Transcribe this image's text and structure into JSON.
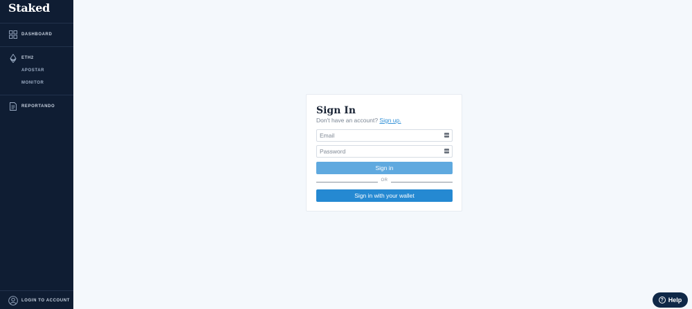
{
  "sidebar": {
    "logo": "Staked",
    "items": [
      {
        "label": "DASHBOARD",
        "icon": "grid-icon"
      },
      {
        "label": "ETH2",
        "icon": "ethereum-icon"
      },
      {
        "label": "APOSTAR",
        "icon": ""
      },
      {
        "label": "MONITOR",
        "icon": ""
      },
      {
        "label": "REPORTANDO",
        "icon": "document-icon"
      }
    ],
    "account": {
      "label": "LOGIN TO ACCOUNT",
      "icon": "user-circle-icon"
    }
  },
  "signin": {
    "title": "Sign In",
    "no_account_text": "Don't have an account?",
    "signup_link": "Sign up.",
    "email_placeholder": "Email",
    "password_placeholder": "Password",
    "signin_button": "Sign in",
    "or_text": "OR",
    "wallet_button": "Sign in with your wallet"
  },
  "help": {
    "label": "Help"
  },
  "colors": {
    "sidebar_bg": "#0f1d33",
    "page_bg": "#f4f8fc",
    "signin_button": "#5fa9df",
    "wallet_button": "#2589d2",
    "link": "#2f8fd6",
    "help_bg": "#0f2847"
  }
}
